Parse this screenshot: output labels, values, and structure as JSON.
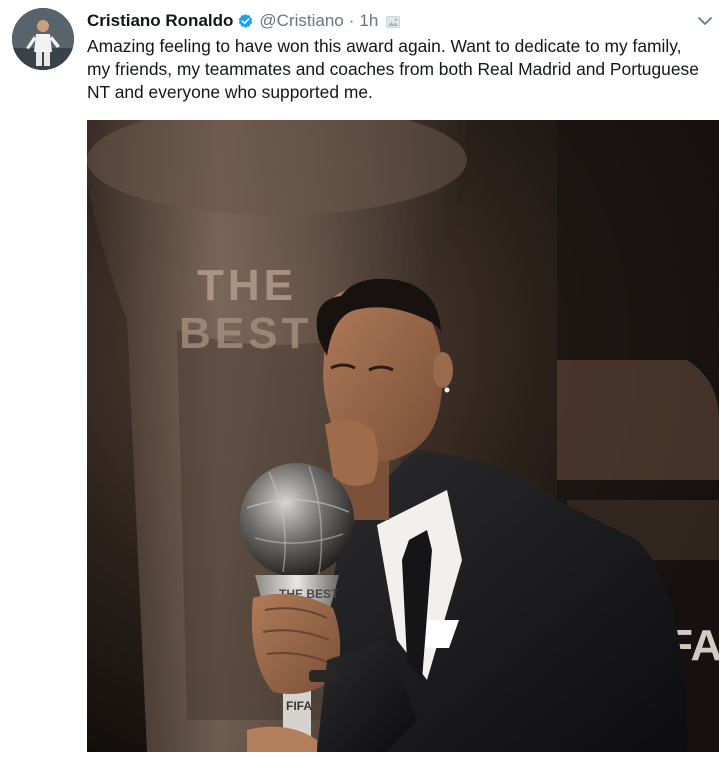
{
  "tweet": {
    "author_name": "Cristiano Ronaldo",
    "handle": "@Cristiano",
    "separator": "·",
    "time": "1h",
    "text_lines": [
      "Amazing feeling to have won this award again. Want to dedicate to my family,",
      "my friends, my teammates and coaches from both Real Madrid and Portuguese",
      "NT and everyone who supported me."
    ]
  },
  "photo": {
    "trophy_text": [
      "THE",
      "BEST"
    ],
    "small_trophy_text": "THE BEST",
    "sponsor_text": "FIFA",
    "base_text": "FIFA"
  },
  "icons": {
    "verified": "verified-badge-icon",
    "chevron": "chevron-down-icon",
    "via": "photo-icon"
  },
  "colors": {
    "verified_blue": "#1da1f2",
    "secondary_text": "#657786",
    "primary_text": "#14171a"
  }
}
